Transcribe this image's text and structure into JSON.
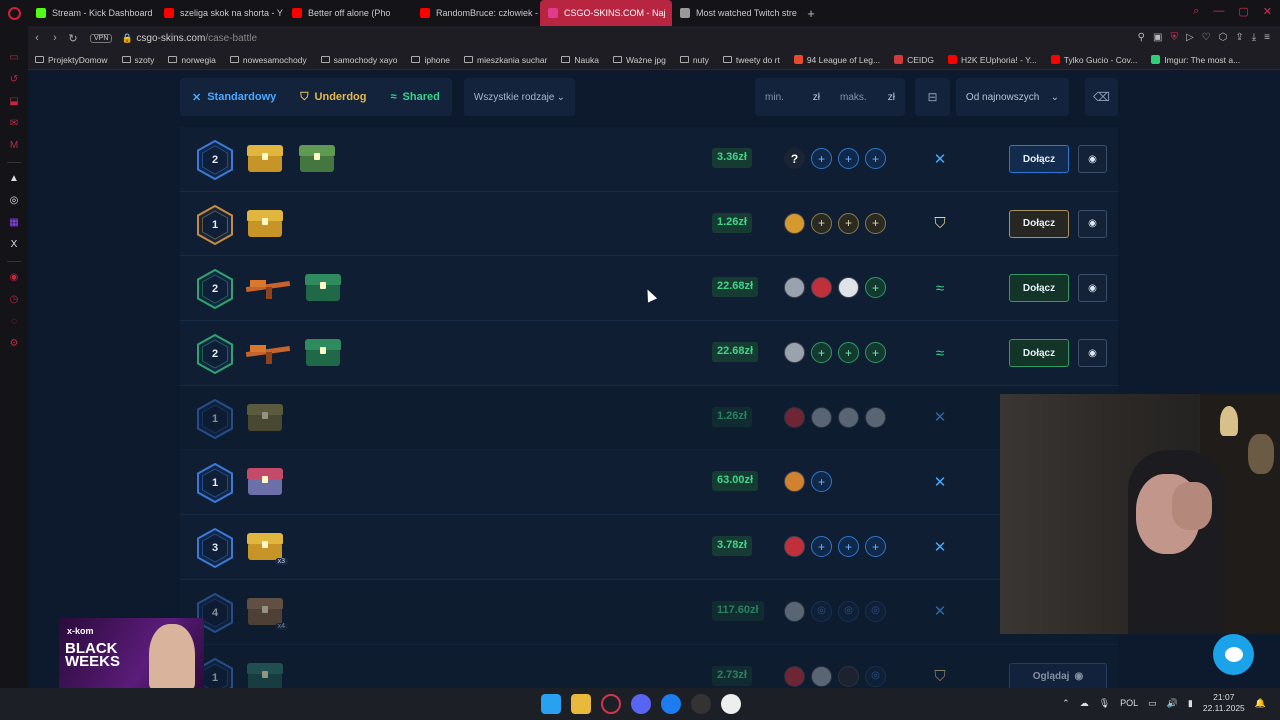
{
  "browser": {
    "tabs": [
      {
        "label": "Stream - Kick Dashboard",
        "color": "#53fc18",
        "active": false
      },
      {
        "label": "szeliga skok na shorta - Y",
        "color": "#ff0000",
        "active": false
      },
      {
        "label": "Better off alone (Pho",
        "color": "#ff0000",
        "active": false
      },
      {
        "label": "RandomBruce: człowiek -",
        "color": "#ff0000",
        "active": false
      },
      {
        "label": "CSGO-SKINS.COM - Naj",
        "color": "#e23a8f",
        "active": true
      },
      {
        "label": "Most watched Twitch stre",
        "color": "#999999",
        "active": false
      }
    ],
    "url_host": "csgo-skins.com",
    "url_path": "/case-battle",
    "vpn_label": "VPN",
    "bookmarks": [
      {
        "label": "ProjektyDomow",
        "type": "folder"
      },
      {
        "label": "szoty",
        "type": "folder"
      },
      {
        "label": "norwegia",
        "type": "folder"
      },
      {
        "label": "nowesamochody",
        "type": "folder"
      },
      {
        "label": "samochody xayo",
        "type": "folder"
      },
      {
        "label": "iphone",
        "type": "folder"
      },
      {
        "label": "mieszkania suchar",
        "type": "folder"
      },
      {
        "label": "Nauka",
        "type": "folder"
      },
      {
        "label": "Ważne jpg",
        "type": "folder"
      },
      {
        "label": "nuty",
        "type": "folder"
      },
      {
        "label": "tweety do rt",
        "type": "folder"
      },
      {
        "label": "94 League of Leg...",
        "type": "site",
        "color": "#e84a2f"
      },
      {
        "label": "CEIDG",
        "type": "site",
        "color": "#d23a3a"
      },
      {
        "label": "H2K EUphoria! - Y...",
        "type": "site",
        "color": "#ff0000"
      },
      {
        "label": "Tylko Gucio - Cov...",
        "type": "site",
        "color": "#ff0000"
      },
      {
        "label": "Imgur: The most a...",
        "type": "site",
        "color": "#2fcf7a"
      }
    ]
  },
  "filters": {
    "standard": "Standardowy",
    "underdog": "Underdog",
    "shared": "Shared",
    "type_select": "Wszystkie rodzaje",
    "min_placeholder": "min.",
    "max_placeholder": "maks.",
    "currency": "zł",
    "sort_select": "Od najnowszych"
  },
  "battles": [
    {
      "rounds": "2",
      "hex": "blue",
      "items": [
        {
          "kind": "case",
          "color": "yellow"
        },
        {
          "kind": "case",
          "color": "green"
        }
      ],
      "price": "3.36zł",
      "players": [
        "q",
        "plus-blue",
        "plus-blue",
        "plus-blue"
      ],
      "mode": "standard",
      "action": "Dołącz",
      "dim": false
    },
    {
      "rounds": "1",
      "hex": "gold",
      "items": [
        {
          "kind": "case",
          "color": "yellow"
        }
      ],
      "price": "1.26zł",
      "players": [
        "av-gold",
        "plus-gold",
        "plus-gold",
        "plus-gold"
      ],
      "mode": "underdog",
      "action": "Dołącz",
      "dim": false
    },
    {
      "rounds": "2",
      "hex": "green",
      "items": [
        {
          "kind": "gun"
        },
        {
          "kind": "case",
          "color": "emerald"
        }
      ],
      "price": "22.68zł",
      "players": [
        "av-grey",
        "av-red",
        "av-white",
        "plus-green"
      ],
      "mode": "shared",
      "action": "Dołącz",
      "dim": false
    },
    {
      "rounds": "2",
      "hex": "green",
      "items": [
        {
          "kind": "gun"
        },
        {
          "kind": "case",
          "color": "emerald"
        }
      ],
      "price": "22.68zł",
      "players": [
        "av-grey",
        "plus-green",
        "plus-green",
        "plus-green"
      ],
      "mode": "shared",
      "action": "Dołącz",
      "dim": false
    },
    {
      "rounds": "1",
      "hex": "blue",
      "items": [
        {
          "kind": "case",
          "color": "olive"
        }
      ],
      "price": "1.26zł",
      "players": [
        "av-red",
        "av-grey",
        "av-grey",
        "av-grey"
      ],
      "mode": "standard",
      "action": "",
      "dim": true
    },
    {
      "rounds": "1",
      "hex": "blue",
      "items": [
        {
          "kind": "case",
          "color": "multi"
        }
      ],
      "price": "63.00zł",
      "players": [
        "av-orange",
        "plus-blue"
      ],
      "mode": "standard",
      "action": "",
      "dim": false
    },
    {
      "rounds": "3",
      "hex": "blue",
      "items": [
        {
          "kind": "case",
          "color": "yellow",
          "qty": "x3"
        }
      ],
      "price": "3.78zł",
      "players": [
        "av-red",
        "plus-blue",
        "plus-blue",
        "plus-blue"
      ],
      "mode": "standard",
      "action": "",
      "dim": false
    },
    {
      "rounds": "4",
      "hex": "blue",
      "items": [
        {
          "kind": "case",
          "color": "bronze",
          "qty": "x4"
        }
      ],
      "price": "117.60zł",
      "players": [
        "av-grey",
        "target",
        "target",
        "target"
      ],
      "mode": "standard",
      "action": "",
      "dim": true
    },
    {
      "rounds": "1",
      "hex": "blue",
      "items": [
        {
          "kind": "case",
          "color": "teal"
        }
      ],
      "price": "2.73zł",
      "players": [
        "av-red",
        "av-grey",
        "av-dark",
        "target"
      ],
      "mode": "underdog",
      "action": "Oglądaj",
      "dim": true
    }
  ],
  "ad": {
    "brand": "x-kom",
    "title_line1": "BLACK",
    "title_line2": "WEEKS"
  },
  "taskbar": {
    "lang": "POL",
    "time": "21:07",
    "date": "22.11.2025"
  }
}
